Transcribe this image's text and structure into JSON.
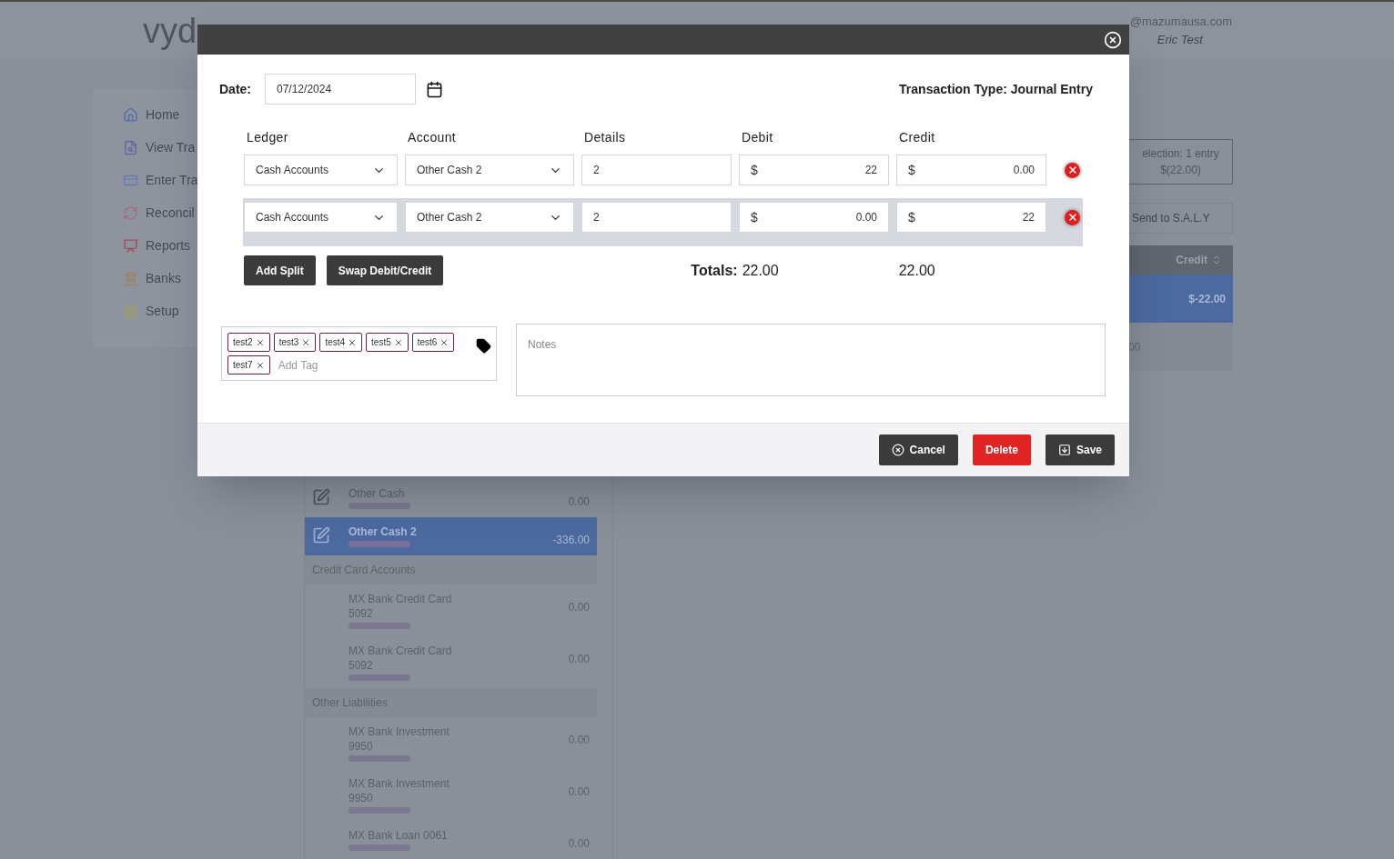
{
  "background": {
    "logo": "vyd",
    "user": {
      "email": "@mazumausa.com",
      "name": "Eric Test"
    },
    "nav": [
      {
        "kind": "home",
        "label": "Home"
      },
      {
        "kind": "view",
        "label": "View Tra"
      },
      {
        "kind": "enter",
        "label": "Enter Tra"
      },
      {
        "kind": "reconcile",
        "label": "Reconcil"
      },
      {
        "kind": "reports",
        "label": "Reports"
      },
      {
        "kind": "banks",
        "label": "Banks"
      },
      {
        "kind": "setup",
        "label": "Setup"
      }
    ],
    "accounts": [
      {
        "kind": "account",
        "name": "Other Cash",
        "amount": "0.00",
        "selected": false,
        "editable": true
      },
      {
        "kind": "account",
        "name": "Other Cash 2",
        "amount": "-336.00",
        "selected": true,
        "editable": true
      },
      {
        "kind": "group",
        "name": "Credit Card Accounts"
      },
      {
        "kind": "account",
        "name": "MX Bank Credit Card 5092",
        "amount": "0.00",
        "selected": false,
        "editable": false
      },
      {
        "kind": "account",
        "name": "MX Bank Credit Card 5092",
        "amount": "0.00",
        "selected": false,
        "editable": false
      },
      {
        "kind": "group",
        "name": "Other Liabilities"
      },
      {
        "kind": "account",
        "name": "MX Bank Investment 9950",
        "amount": "0.00",
        "selected": false,
        "editable": false
      },
      {
        "kind": "account",
        "name": "MX Bank Investment 9950",
        "amount": "0.00",
        "selected": false,
        "editable": false
      },
      {
        "kind": "account",
        "name": "MX Bank Loan 0061",
        "amount": "0.00",
        "selected": false,
        "editable": false
      }
    ],
    "summary": {
      "selection": [
        "election: 1 entry",
        "$(22.00)"
      ],
      "send_button": "Send to S.A.L.Y",
      "table": {
        "columns": [
          "Credit"
        ],
        "rows": [
          {
            "cells": [
              "$-22.00"
            ],
            "selected": true
          },
          {
            "cells": [
              "00"
            ],
            "selected": false
          }
        ]
      }
    }
  },
  "modal": {
    "date_label": "Date:",
    "date": "07/12/2024",
    "transaction_type": "Transaction Type: Journal Entry",
    "columns": [
      "Ledger",
      "Account",
      "Details",
      "Debit",
      "Credit"
    ],
    "splits": [
      {
        "ledger": "Cash Accounts",
        "account": "Other Cash 2",
        "details": "2",
        "debit": {
          "currency": "$",
          "amount": "22"
        },
        "credit": {
          "currency": "$",
          "amount": "0.00"
        },
        "selected": false
      },
      {
        "ledger": "Cash Accounts",
        "account": "Other Cash 2",
        "details": "2",
        "debit": {
          "currency": "$",
          "amount": "0.00"
        },
        "credit": {
          "currency": "$",
          "amount": "22"
        },
        "selected": true
      }
    ],
    "add_split": "Add Split",
    "swap": "Swap Debit/Credit",
    "totals": {
      "label": "Totals:",
      "debit": "22.00",
      "credit": "22.00"
    },
    "tags": [
      "test2",
      "test3",
      "test4",
      "test5",
      "test6",
      "test7"
    ],
    "tag_placeholder": "Add Tag",
    "notes_placeholder": "Notes",
    "footer_buttons": [
      {
        "kind": "cancel",
        "label": "Cancel"
      },
      {
        "kind": "delete",
        "label": "Delete"
      },
      {
        "kind": "save",
        "label": "Save"
      }
    ]
  }
}
